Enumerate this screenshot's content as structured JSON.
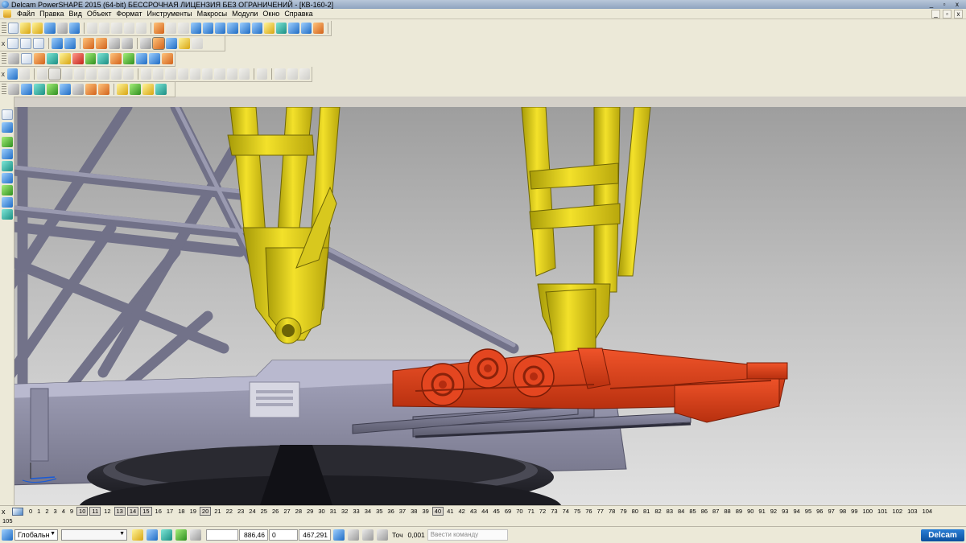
{
  "window": {
    "title": "Delcam PowerSHAPE 2015 (64-bit) БЕССРОЧНАЯ ЛИЦЕНЗИЯ БЕЗ ОГРАНИЧЕНИЙ - [КВ-160-2]",
    "minimize": "_",
    "restore": "▫",
    "close": "x"
  },
  "menu": {
    "items": [
      "Файл",
      "Правка",
      "Вид",
      "Объект",
      "Формат",
      "Инструменты",
      "Макросы",
      "Модули",
      "Окно",
      "Справка"
    ],
    "doc_min": "_",
    "doc_restore": "▫",
    "doc_close": "x"
  },
  "toolbars": {
    "close_glyph": "x"
  },
  "levels": {
    "items": [
      "0",
      "1",
      "2",
      "3",
      "4",
      "9",
      "10",
      "11",
      "12",
      "13",
      "14",
      "15",
      "16",
      "17",
      "18",
      "19",
      "20",
      "21",
      "22",
      "23",
      "24",
      "25",
      "26",
      "27",
      "28",
      "29",
      "30",
      "31",
      "32",
      "33",
      "34",
      "35",
      "36",
      "37",
      "38",
      "39",
      "40",
      "41",
      "42",
      "43",
      "44",
      "45",
      "69",
      "70",
      "71",
      "72",
      "73",
      "74",
      "75",
      "76",
      "77",
      "78",
      "79",
      "80",
      "81",
      "82",
      "83",
      "84",
      "85",
      "86",
      "87",
      "88",
      "89",
      "90",
      "91",
      "92",
      "93",
      "94",
      "95",
      "96",
      "97",
      "98",
      "99",
      "100",
      "101",
      "102",
      "103",
      "104"
    ],
    "boxed": [
      "10",
      "11",
      "13",
      "14",
      "15",
      "20",
      "40"
    ],
    "overflow": "105"
  },
  "status": {
    "workplane": "Глобальн",
    "x": "886,46",
    "y": "0",
    "z": "467,291",
    "tol_label": "Точ",
    "tol_value": "0,001",
    "command_placeholder": "Ввести команду",
    "logo": "Delcam"
  }
}
